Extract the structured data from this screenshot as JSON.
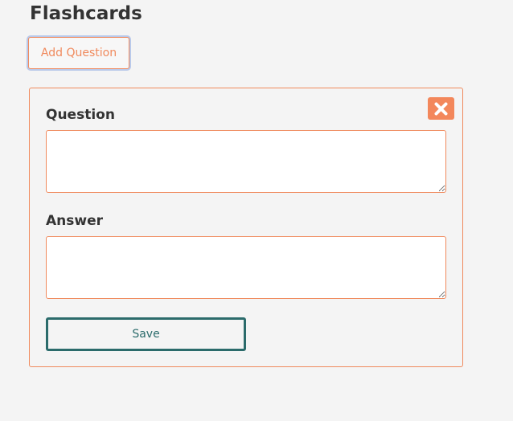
{
  "page": {
    "title": "Flashcards"
  },
  "toolbar": {
    "add_question_label": "Add Question"
  },
  "card": {
    "question_label": "Question",
    "question_value": "",
    "answer_label": "Answer",
    "answer_value": "",
    "save_label": "Save",
    "close_icon": "close-icon"
  },
  "colors": {
    "accent": "#f08a5d",
    "save_border": "#2b6b6b",
    "background": "#f4f4f4",
    "text": "#333333"
  }
}
